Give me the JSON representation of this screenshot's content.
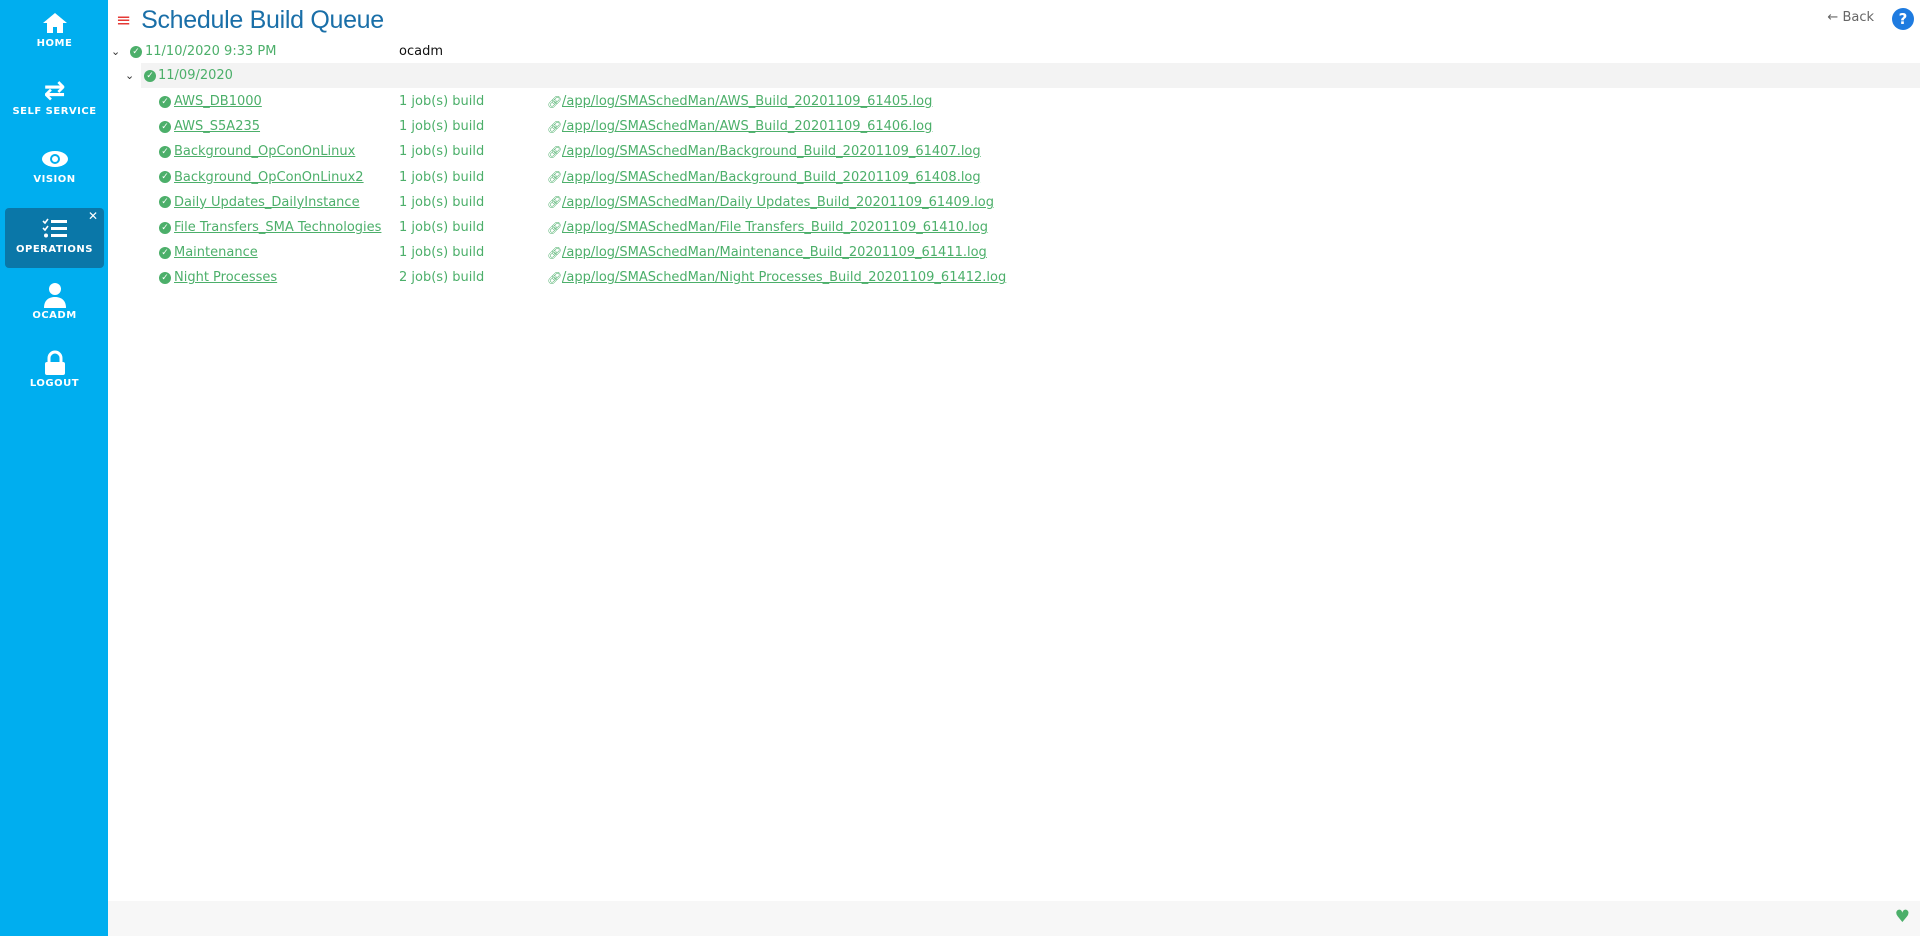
{
  "sidebar": {
    "items": [
      {
        "label": "HOME",
        "icon": "home-icon"
      },
      {
        "label": "SELF SERVICE",
        "icon": "swap-icon"
      },
      {
        "label": "VISION",
        "icon": "eye-icon"
      },
      {
        "label": "OPERATIONS",
        "icon": "checklist-icon",
        "active": true,
        "close": "✕"
      },
      {
        "label": "OCADM",
        "icon": "user-icon"
      },
      {
        "label": "LOGOUT",
        "icon": "lock-icon"
      }
    ]
  },
  "header": {
    "title": "Schedule Build Queue",
    "back_label": "Back",
    "help": "?"
  },
  "colors": {
    "sidebar": "#00aeef",
    "active": "#0a77a8",
    "success": "#4caf6a",
    "title": "#1a6fa8"
  },
  "tree": {
    "root": {
      "label": "11/10/2020 9:33 PM",
      "user": "ocadm"
    },
    "date": {
      "label": "11/09/2020"
    },
    "items": [
      {
        "name": "AWS_DB1000",
        "jobs": "1 job(s) build",
        "log": "/app/log/SMASchedMan/AWS_Build_20201109_61405.log"
      },
      {
        "name": "AWS_S5A235",
        "jobs": "1 job(s) build",
        "log": "/app/log/SMASchedMan/AWS_Build_20201109_61406.log"
      },
      {
        "name": "Background_OpConOnLinux",
        "jobs": "1 job(s) build",
        "log": "/app/log/SMASchedMan/Background_Build_20201109_61407.log"
      },
      {
        "name": "Background_OpConOnLinux2",
        "jobs": "1 job(s) build",
        "log": "/app/log/SMASchedMan/Background_Build_20201109_61408.log"
      },
      {
        "name": "Daily Updates_DailyInstance",
        "jobs": "1 job(s) build",
        "log": "/app/log/SMASchedMan/Daily Updates_Build_20201109_61409.log"
      },
      {
        "name": "File Transfers_SMA Technologies",
        "jobs": "1 job(s) build",
        "log": "/app/log/SMASchedMan/File Transfers_Build_20201109_61410.log"
      },
      {
        "name": "Maintenance",
        "jobs": "1 job(s) build",
        "log": "/app/log/SMASchedMan/Maintenance_Build_20201109_61411.log"
      },
      {
        "name": "Night Processes",
        "jobs": "2 job(s) build",
        "log": "/app/log/SMASchedMan/Night Processes_Build_20201109_61412.log"
      }
    ]
  }
}
